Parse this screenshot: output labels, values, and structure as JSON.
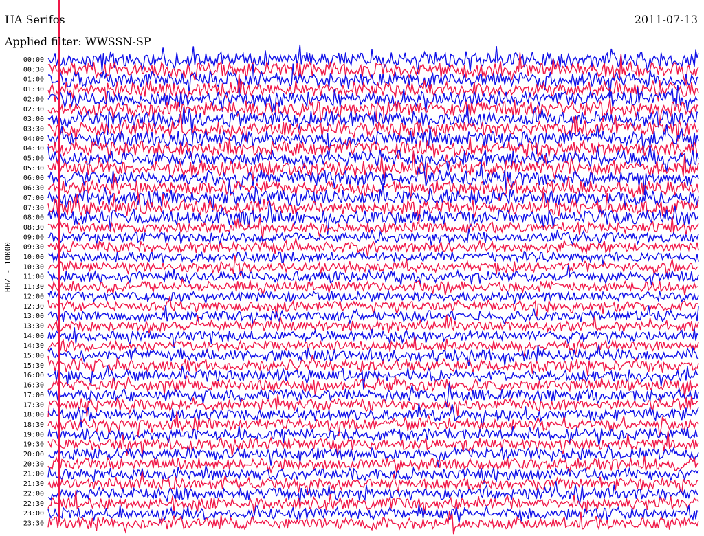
{
  "header": {
    "station": "HA Serifos",
    "date": "2011-07-13",
    "filter": "Applied filter: WWSSN-SP",
    "channel": "HHZ - 10000"
  },
  "chart_data": {
    "type": "line",
    "title": "HA Serifos",
    "subtitle": "Applied filter: WWSSN-SP",
    "ylabel": "HHZ - 10000",
    "row_labels": [
      "00:00",
      "00:30",
      "01:00",
      "01:30",
      "02:00",
      "02:30",
      "03:00",
      "03:30",
      "04:00",
      "04:30",
      "05:00",
      "05:30",
      "06:00",
      "06:30",
      "07:00",
      "07:30",
      "08:00",
      "08:30",
      "09:00",
      "09:30",
      "10:00",
      "10:30",
      "11:00",
      "11:30",
      "12:00",
      "12:30",
      "13:00",
      "13:30",
      "14:00",
      "14:30",
      "15:00",
      "15:30",
      "16:00",
      "16:30",
      "17:00",
      "17:30",
      "18:00",
      "18:30",
      "19:00",
      "19:30",
      "20:00",
      "20:30",
      "21:00",
      "21:30",
      "22:00",
      "22:30",
      "23:00",
      "23:30"
    ],
    "trace_colors": [
      "#1010e8",
      "#f01848"
    ],
    "grid": false
  }
}
